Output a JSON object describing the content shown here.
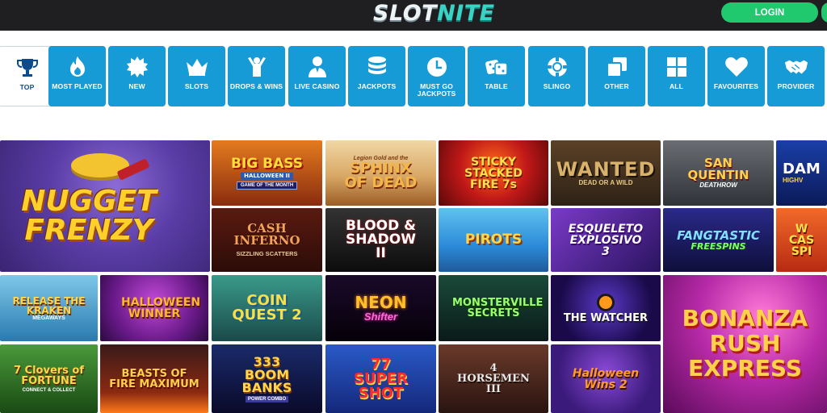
{
  "header": {
    "logo_part1": "SLOT",
    "logo_part2": "NITE",
    "login_label": "LOGIN"
  },
  "categories": [
    {
      "label": "TOP",
      "icon": "trophy-icon",
      "active": true
    },
    {
      "label": "MOST PLAYED",
      "icon": "flame-icon"
    },
    {
      "label": "NEW",
      "icon": "starburst-icon"
    },
    {
      "label": "SLOTS",
      "icon": "crown-icon"
    },
    {
      "label": "DROPS & WINS",
      "icon": "celebrate-person-icon"
    },
    {
      "label": "LIVE CASINO",
      "icon": "dealer-icon"
    },
    {
      "label": "JACKPOTS",
      "icon": "coin-stack-icon"
    },
    {
      "label": "MUST GO JACKPOTS",
      "icon": "clock-icon"
    },
    {
      "label": "TABLE",
      "icon": "dice-icon"
    },
    {
      "label": "SLINGO",
      "icon": "chip-icon"
    },
    {
      "label": "OTHER",
      "icon": "squares-icon"
    },
    {
      "label": "ALL",
      "icon": "grid-icon"
    },
    {
      "label": "FAVOURITES",
      "icon": "heart-icon"
    },
    {
      "label": "PROVIDER",
      "icon": "handshake-icon"
    }
  ],
  "games": {
    "nugget_frenzy": "NUGGET FRENZY",
    "big_bass": "BIG BASS",
    "big_bass_sub": "HALLOWEEN II",
    "big_bass_badge": "GAME OF THE MONTH",
    "sphinx_top": "Legion Gold and the",
    "sphinx": "SPHINX OF DEAD",
    "sticky": "STICKY STACKED FIRE 7s",
    "wanted": "WANTED",
    "wanted_sub": "DEAD OR A WILD",
    "san_quentin": "SAN QUENTIN",
    "san_quentin_sub": "DEATHROW",
    "dam": "DAM",
    "dam_sub": "HIGHV",
    "cash_inferno": "CASH INFERNO",
    "cash_inferno_sub": "SIZZLING SCATTERS",
    "blood_shadow": "BLOOD & SHADOW II",
    "pirots": "PIROTS",
    "esqueleto": "ESQUELETO EXPLOSIVO 3",
    "fangtastic": "FANGTASTIC",
    "fangtastic_sub": "FREESPINS",
    "wild_cash": "W CAS SPI",
    "kraken": "RELEASE THE KRAKEN",
    "kraken_sub": "MEGAWAYS",
    "halloween_winner": "HALLOWEEN WINNER",
    "coin_quest": "COIN QUEST 2",
    "neon_shifter": "NEON",
    "neon_shifter_sub": "Shifter",
    "monsterville": "MONSTERVILLE SECRETS",
    "watcher": "THE WATCHER",
    "bonanza": "BONANZA RUSH EXPRESS",
    "clovers": "7 Clovers of FORTUNE",
    "clovers_sub": "CONNECT & COLLECT",
    "beasts": "BEASTS OF FIRE MAXIMUM",
    "boom_banks": "333 BOOM BANKS",
    "boom_banks_sub": "POWER COMBO",
    "super_shot": "77 SUPER SHOT",
    "horsemen": "4 HORSEMEN III",
    "halloween_wins": "Halloween Wins 2"
  }
}
